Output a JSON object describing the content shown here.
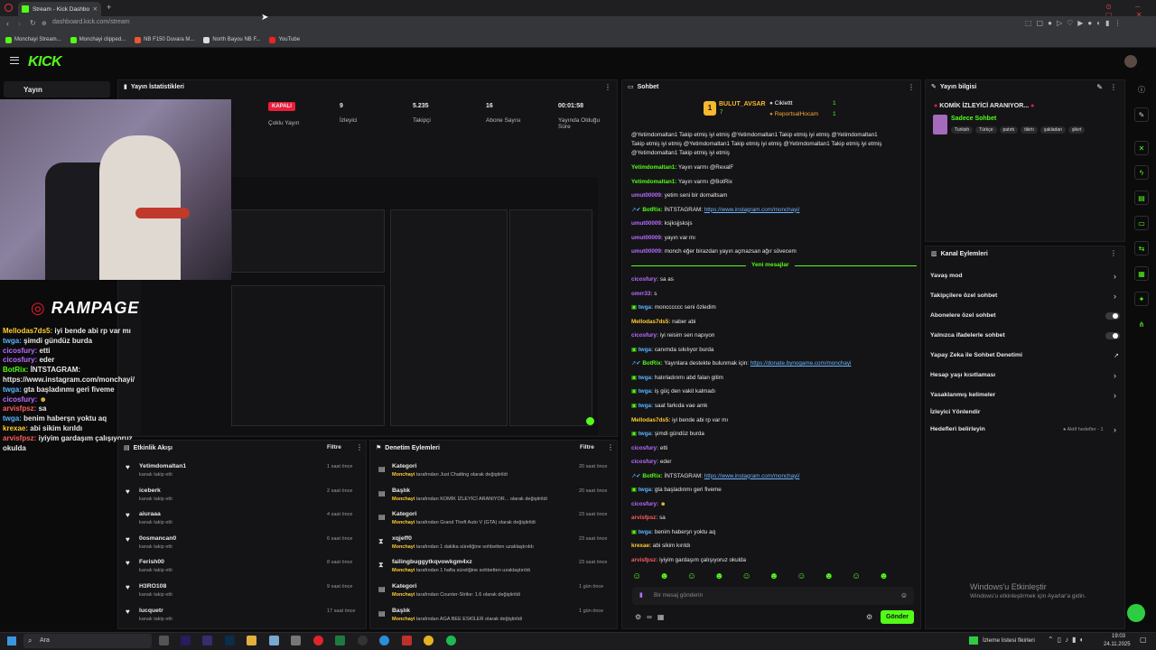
{
  "browser": {
    "tab_title": "Stream - Kick Dashbo",
    "url": "dashboard.kick.com/stream",
    "bookmarks": [
      "Monchayi Stream...",
      "Monchayi clipped...",
      "NB F150 Duvara M...",
      "North Bayou NB F...",
      "YouTube"
    ]
  },
  "kick": {
    "logo": "KICK"
  },
  "sidebar": {
    "active": "Yayın"
  },
  "stats": {
    "header": "Yayın İstatistikleri",
    "status_badge": "KAPALI",
    "multi": "Çoklu Yayın",
    "viewers_value": "9",
    "viewers_label": "İzleyici",
    "followers_value": "5.235",
    "followers_label": "Takipçi",
    "subs_value": "16",
    "subs_label": "Abone Sayısı",
    "uptime_value": "00:01:58",
    "uptime_label1": "Yayında Olduğu",
    "uptime_label2": "Süre"
  },
  "overlay": {
    "brand": "RAMPAGE",
    "chat": [
      {
        "user": "Mellodas7ds5:",
        "msg": "iyi bende abi rp var mı"
      },
      {
        "user": "twga:",
        "msg": "şimdi gündüz burda"
      },
      {
        "user": "cicosfury:",
        "msg": "etti"
      },
      {
        "user": "cicosfury:",
        "msg": "eder"
      },
      {
        "user": "BotRix:",
        "msg": "İNTSTAGRAM:"
      },
      {
        "user": "",
        "msg": "https://www.instagram.com/monchayi/"
      },
      {
        "user": "twga:",
        "msg": "gta başladınmı geri fiveme"
      },
      {
        "user": "cicosfury:",
        "msg": ""
      },
      {
        "user": "arvisfpsz:",
        "msg": "sa"
      },
      {
        "user": "twga:",
        "msg": "benim haberşn yoktu aq"
      },
      {
        "user": "krexae:",
        "msg": "abi sikim kırıldı"
      },
      {
        "user": "arvisfpsz:",
        "msg": "iyiyim gardaşım çalışıyoruz okulda"
      }
    ]
  },
  "activity": {
    "header": "Etkinlik Akışı",
    "filter": "Filtre",
    "items": [
      {
        "name": "Yetimdomaltan1",
        "desc": "kanalı takip etti",
        "time": "1 saat önce"
      },
      {
        "name": "iceberk",
        "desc": "kanalı takip etti",
        "time": "2 saat önce"
      },
      {
        "name": "aiuraaa",
        "desc": "kanalı takip etti",
        "time": "4 saat önce"
      },
      {
        "name": "0osmancan0",
        "desc": "kanalı takip etti",
        "time": "6 saat önce"
      },
      {
        "name": "Ferish00",
        "desc": "kanalı takip etti",
        "time": "8 saat önce"
      },
      {
        "name": "H3RO108",
        "desc": "kanalı takip etti",
        "time": "9 saat önce"
      },
      {
        "name": "lucquetr",
        "desc": "kanalı takip etti",
        "time": "17 saat önce"
      }
    ]
  },
  "moderation": {
    "header": "Denetim Eylemleri",
    "filter": "Filtre",
    "items": [
      {
        "title": "Kategori",
        "actor": "Monchayi",
        "text": "tarafından Just Chatting olarak değiştirildi",
        "time": "20 saat önce"
      },
      {
        "title": "Başlık",
        "actor": "Monchayi",
        "text": "tarafından KOMİK İZLEYİCİ ARANIYOR... olarak değiştirildi",
        "time": "20 saat önce"
      },
      {
        "title": "Kategori",
        "actor": "Monchayi",
        "text": "tarafından Grand Theft Auto V (GTA) olarak değiştirildi",
        "time": "23 saat önce"
      },
      {
        "title": "xqjeff0",
        "actor": "Monchayi",
        "text": "tarafından 1 dakika süreliğine sohbetten uzaklaştırıldı",
        "time": "23 saat önce"
      },
      {
        "title": "failingbuggytkqvowkgm4xz",
        "actor": "Monchayi",
        "text": "tarafından 1 hafta süreliğine sohbetten uzaklaştırıldı",
        "time": "23 saat önce"
      },
      {
        "title": "Kategori",
        "actor": "Monchayi",
        "text": "tarafından Counter-Strike: 1.6 olarak değiştirildi",
        "time": "1 gün önce"
      },
      {
        "title": "Başlık",
        "actor": "Monchayi",
        "text": "tarafından AGA BEE ESKİLER olarak değiştirildi",
        "time": "1 gün önce"
      }
    ]
  },
  "chat": {
    "header": "Sohbet",
    "top": [
      {
        "user": "BULUT_AVSAR",
        "count": "7"
      },
      {
        "user": "Ciklettt",
        "count": "1"
      },
      {
        "user": "ReportsalHocam",
        "count": "1"
      }
    ],
    "spam": "@Yetimdomaltan1 Takip etmiş iyi etmiş @Yetimdomaltan1 Takip etmiş iyi etmiş @Yetimdomaltan1",
    "spam2": "Takip etmiş iyi etmiş @Yetimdomaltan1 Takip etmiş iyi etmiş @Yetimdomaltan1 Takip etmiş iyi etmiş",
    "spam3": "@Yetimdomaltan1 Takip etmiş iyi etmiş",
    "new_messages": "Yeni mesajlar",
    "messages_top": [
      {
        "user": "Yetimdomaltan1:",
        "msg": "Yayın varmı @RexalF",
        "c": "u2"
      },
      {
        "user": "Yetimdomaltan1:",
        "msg": "Yayın varmı @BotRix",
        "c": "u2"
      },
      {
        "user": "umut00009:",
        "msg": "yetim seni bir domaltsam",
        "c": "u1"
      },
      {
        "user": "BotRix:",
        "msg": "İNTSTAGRAM:",
        "link": "https://www.instagram.com/monchayi/",
        "c": "u2"
      },
      {
        "user": "umut00009:",
        "msg": "ksjksjjsksjs",
        "c": "u1"
      },
      {
        "user": "umut00009:",
        "msg": "yayın var mı",
        "c": "u1"
      },
      {
        "user": "umut00009:",
        "msg": "monch eğer birazdan yayın açmazsan ağır sövecem",
        "c": "u1"
      }
    ],
    "messages": [
      {
        "user": "cicosfury:",
        "msg": "sa as",
        "c": "u1"
      },
      {
        "user": "omrr33:",
        "msg": "s",
        "c": "u1"
      },
      {
        "user": "twga:",
        "msg": "moncccccc seni özledim",
        "c": "u4"
      },
      {
        "user": "Mellodas7ds5:",
        "msg": "naber abi",
        "c": "u5"
      },
      {
        "user": "cicosfury:",
        "msg": "iyi reisim sen napıyon",
        "c": "u1"
      },
      {
        "user": "twga:",
        "msg": "canımda sıkılıyor burda",
        "c": "u4"
      },
      {
        "user": "BotRix:",
        "msg": "Yayınlara destekte bulunmak için:",
        "link": "https://donate.bynogame.com/monchayi",
        "c": "u2"
      },
      {
        "user": "twga:",
        "msg": "hatırladınmı abd falan gitim",
        "c": "u4"
      },
      {
        "user": "twga:",
        "msg": "iş güç den vakit kalmadı",
        "c": "u4"
      },
      {
        "user": "twga:",
        "msg": "saat farkıda vae amk",
        "c": "u4"
      },
      {
        "user": "Mellodas7ds5:",
        "msg": "iyi bende abi rp var mı",
        "c": "u5"
      },
      {
        "user": "twga:",
        "msg": "şimdi gündüz burda",
        "c": "u4"
      },
      {
        "user": "cicosfury:",
        "msg": "etti",
        "c": "u1"
      },
      {
        "user": "cicosfury:",
        "msg": "eder",
        "c": "u1"
      },
      {
        "user": "BotRix:",
        "msg": "İNTSTAGRAM:",
        "link": "https://www.instagram.com/monchayi/",
        "c": "u2"
      },
      {
        "user": "twga:",
        "msg": "gta başladınmı geri fiveme",
        "c": "u4"
      },
      {
        "user": "cicosfury:",
        "msg": "",
        "c": "u1"
      },
      {
        "user": "arvisfpsz:",
        "msg": "sa",
        "c": "u3"
      },
      {
        "user": "twga:",
        "msg": "benim haberşn yoktu aq",
        "c": "u4"
      },
      {
        "user": "krexae:",
        "msg": "abi sikim kırıldı",
        "c": "u5"
      },
      {
        "user": "arvisfpsz:",
        "msg": "iyiyim gardaşım çalışıyoruz okulda",
        "c": "u3"
      }
    ],
    "input_placeholder": "Bir mesaj gönderin",
    "send": "Gönder"
  },
  "info": {
    "header": "Yayın bilgisi",
    "title": "KOMİK İZLEYİCİ ARANIYOR...",
    "category": "Sadece Sohbet",
    "tags": [
      "Turkish",
      "Türkçe",
      "patırtı",
      "tikirtı",
      "şakladan",
      "şikırt"
    ]
  },
  "actions": {
    "header": "Kanal Eylemleri",
    "items": [
      {
        "label": "Yavaş mod",
        "kind": "arrow"
      },
      {
        "label": "Takipçilere özel sohbet",
        "kind": "arrow"
      },
      {
        "label": "Abonelere özel sohbet",
        "kind": "toggle"
      },
      {
        "label": "Yalnızca ifadelerle sohbet",
        "kind": "toggle"
      },
      {
        "label": "Yapay Zeka ile Sohbet Denetimi",
        "kind": "ext"
      },
      {
        "label": "Hesap yaşı kısıtlaması",
        "kind": "arrow"
      },
      {
        "label": "Yasaklanmış kelimeler",
        "kind": "arrow"
      },
      {
        "label": "İzleyici Yönlendir",
        "kind": "none"
      },
      {
        "label": "Hedefleri belirleyin",
        "kind": "arrow",
        "extra": "Aktif hedefler - 1"
      }
    ]
  },
  "windows": {
    "activate": "Windows'u Etkinleştir",
    "activate_sub": "Windows'u etkinleştirmek için Ayarlar'a gidin.",
    "search": "Ara",
    "watchlist": "İzleme listesi fikirleri",
    "time": "19:03",
    "date": "24.11.2025"
  },
  "colors": {
    "accent": "#53fc18",
    "badge_red": "#e91e3c"
  }
}
